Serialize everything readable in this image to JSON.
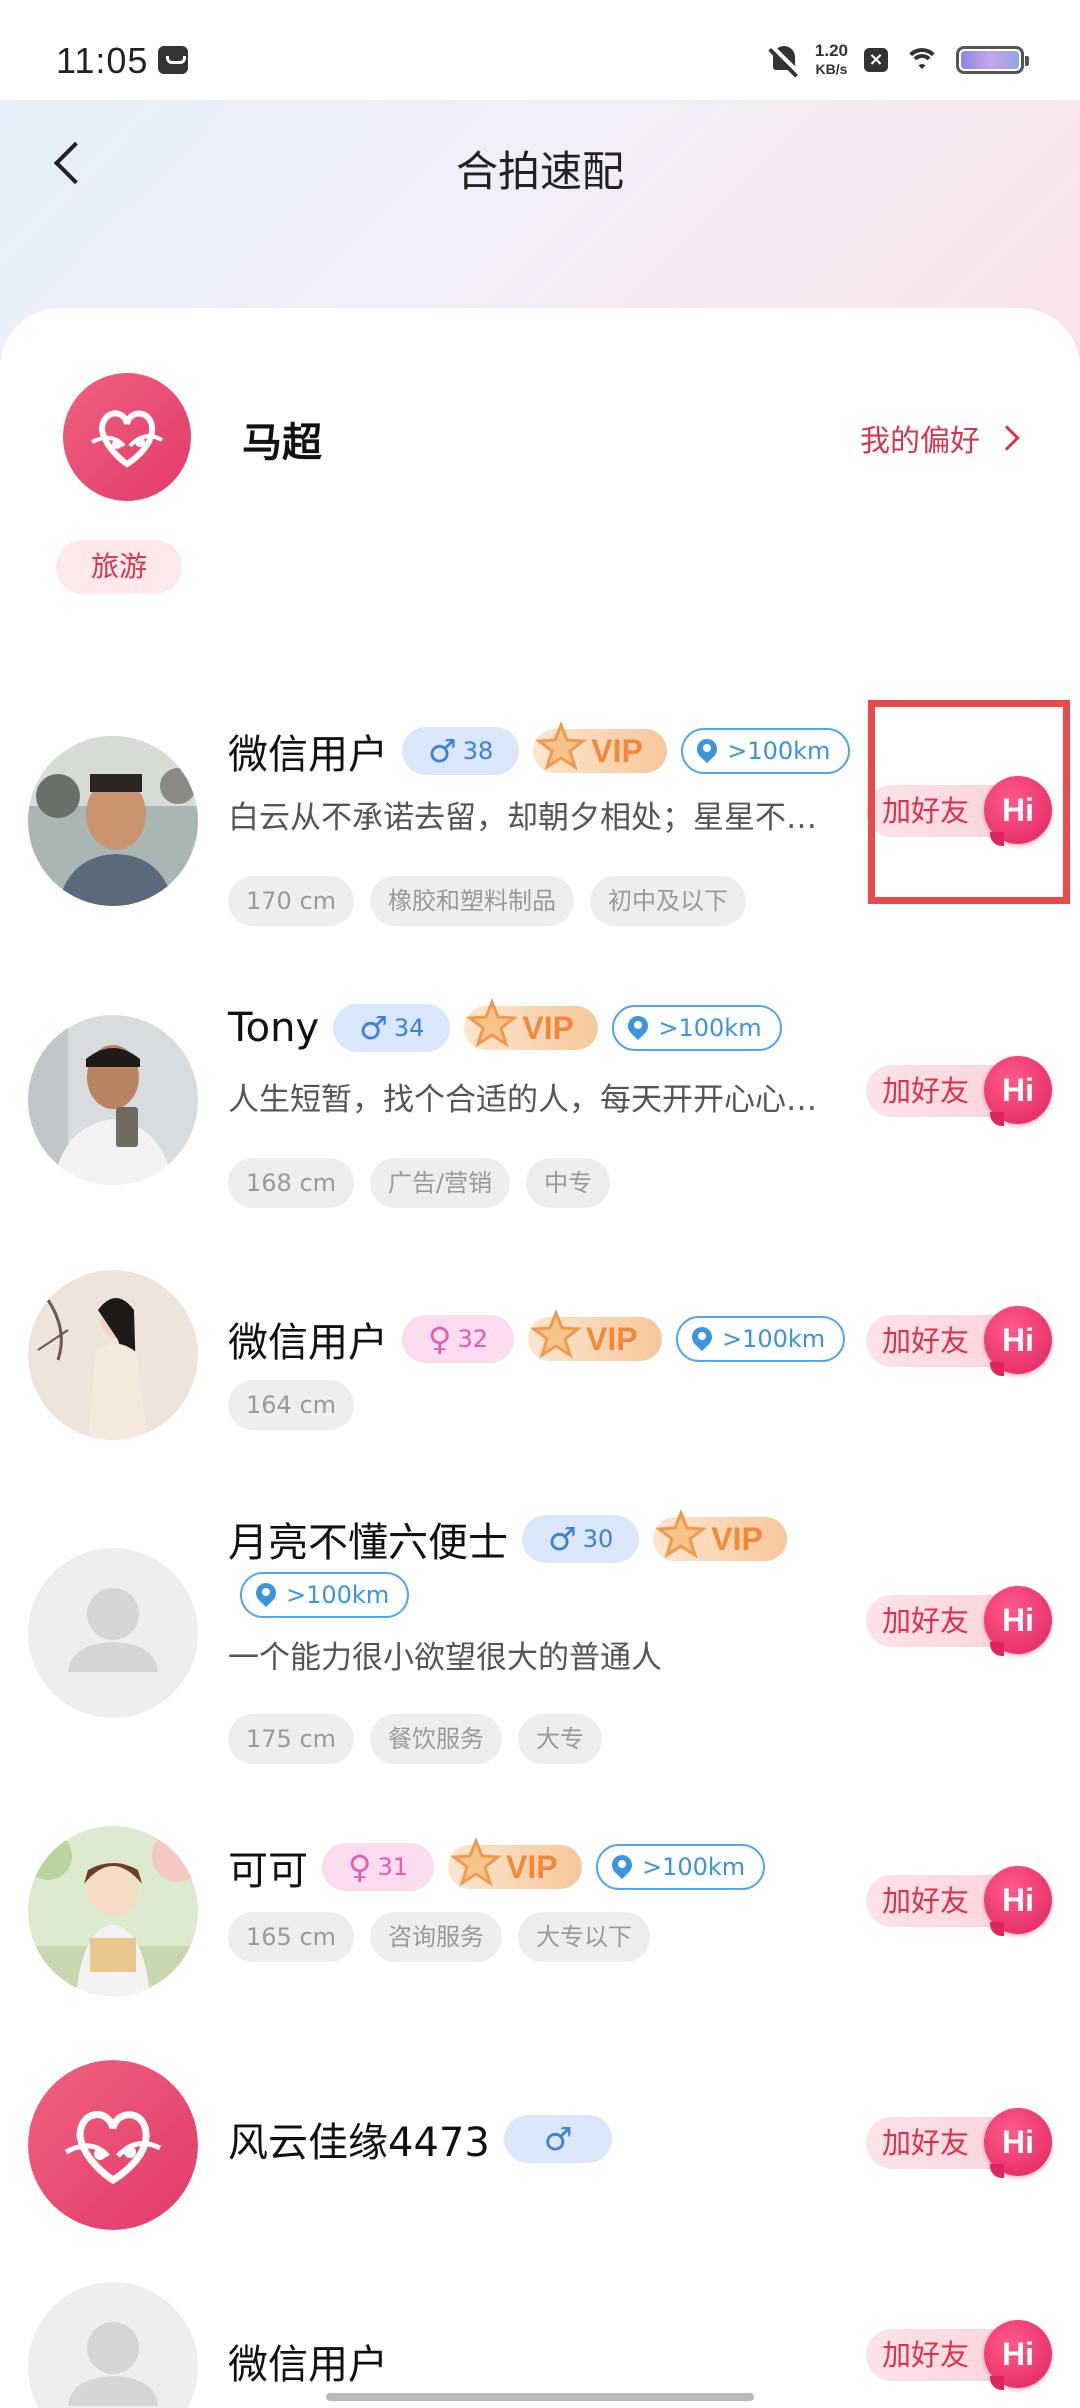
{
  "status_bar": {
    "time": "11:05",
    "net_speed_value": "1.20",
    "net_speed_unit": "KB/s"
  },
  "nav": {
    "title": "合拍速配"
  },
  "profile": {
    "name": "马超",
    "preferences_label": "我的偏好",
    "interest_tags": [
      "旅游"
    ]
  },
  "actions": {
    "add_friend_label": "加好友",
    "hi_label": "Hi",
    "vip_label": "VIP"
  },
  "users": [
    {
      "name": "微信用户",
      "gender": "♂",
      "age": "38",
      "vip": true,
      "distance": ">100km",
      "bio": "白云从不承诺去留，却朝夕相处；星星不…",
      "tags": [
        "170 cm",
        "橡胶和塑料制品",
        "初中及以下"
      ]
    },
    {
      "name": "Tony",
      "gender": "♂",
      "age": "34",
      "vip": true,
      "distance": ">100km",
      "bio": "人生短暂，找个合适的人，每天开开心心…",
      "tags": [
        "168 cm",
        "广告/营销",
        "中专"
      ]
    },
    {
      "name": "微信用户",
      "gender": "♀",
      "age": "32",
      "vip": true,
      "distance": ">100km",
      "bio": "",
      "tags": [
        "164 cm"
      ]
    },
    {
      "name": "月亮不懂六便士",
      "gender": "♂",
      "age": "30",
      "vip": true,
      "distance": ">100km",
      "bio": "一个能力很小欲望很大的普通人",
      "tags": [
        "175 cm",
        "餐饮服务",
        "大专"
      ]
    },
    {
      "name": "可可",
      "gender": "♀",
      "age": "31",
      "vip": true,
      "distance": ">100km",
      "bio": "",
      "tags": [
        "165 cm",
        "咨询服务",
        "大专以下"
      ]
    },
    {
      "name": "风云佳缘4473",
      "gender": "♂",
      "age": "",
      "vip": false,
      "distance": "",
      "bio": "",
      "tags": []
    },
    {
      "name": "微信用户",
      "gender": "",
      "age": "",
      "vip": false,
      "distance": "",
      "bio": "",
      "tags": []
    }
  ]
}
